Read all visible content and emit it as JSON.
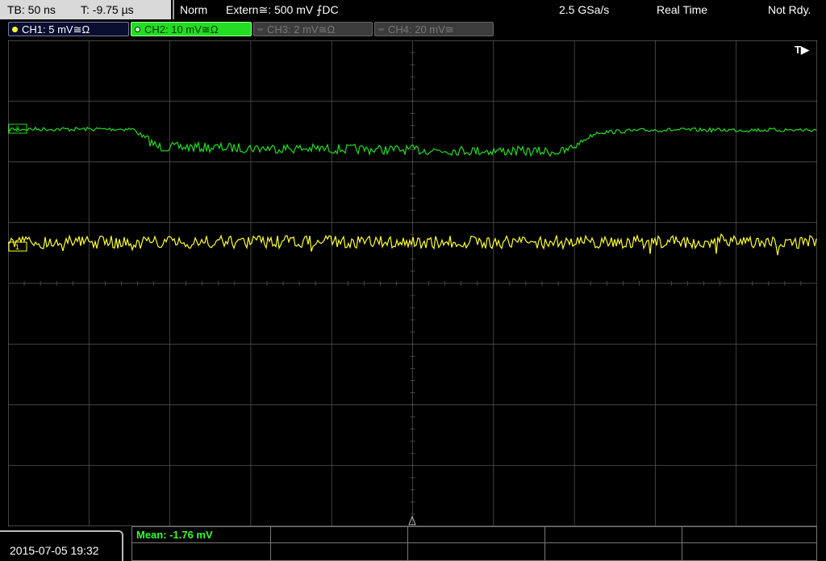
{
  "status": {
    "timebase": "TB: 50 ns",
    "trigger_time": "T: -9.75 µs",
    "mode": "Norm",
    "trigger_source": "Extern≅: 500 mV ⨍DC",
    "sample_rate": "2.5 GSa/s",
    "acq_mode": "Real Time",
    "state": "Not Rdy."
  },
  "channels": [
    {
      "label": "CH1: 5 mV≅Ω",
      "color": "#ffff33",
      "active": true
    },
    {
      "label": "CH2: 10 mV≅Ω",
      "color": "#22dd22",
      "active": true,
      "selected": true
    },
    {
      "label": "CH3: 2 mV≅Ω",
      "color": "#5a5a5a",
      "active": false
    },
    {
      "label": "CH4: 20 mV≅",
      "color": "#5a5a5a",
      "active": false
    }
  ],
  "trigger_marker": "T▶",
  "marker_ch2": "2",
  "marker_ch1": "1",
  "datetime": "2015-07-05 19:32",
  "measurement": {
    "mean": "Mean: -1.76 mV"
  },
  "colors": {
    "ch1": "#ffff33",
    "ch2": "#22dd22",
    "grid": "#5a5a5a",
    "background": "#000000"
  }
}
